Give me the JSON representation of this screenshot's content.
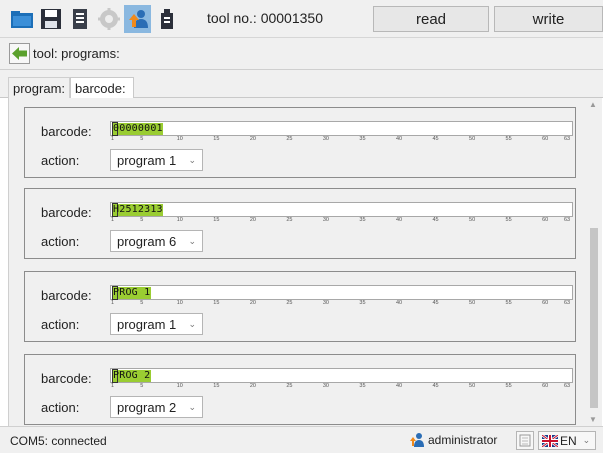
{
  "toolbar": {
    "tool_no": "tool no.: 00001350",
    "read_label": "read",
    "write_label": "write",
    "icons": [
      "open-folder-icon",
      "save-icon",
      "printer-icon",
      "settings-gear-icon",
      "user-upload-icon",
      "usb-device-icon"
    ]
  },
  "breadcrumb": {
    "text": "tool: programs:"
  },
  "tabs": [
    {
      "label": "program:"
    },
    {
      "label": "barcode:"
    }
  ],
  "form_labels": {
    "barcode": "barcode:",
    "action": "action:"
  },
  "ruler_ticks": [
    "1",
    "5",
    "10",
    "15",
    "20",
    "25",
    "30",
    "35",
    "40",
    "45",
    "50",
    "55",
    "60",
    "63"
  ],
  "entries": [
    {
      "barcode": "00000001",
      "action": "program 1"
    },
    {
      "barcode": "H2512313",
      "action": "program 6"
    },
    {
      "barcode": "PROG 1",
      "action": "program 1"
    },
    {
      "barcode": "PROG 2",
      "action": "program 2"
    }
  ],
  "statusbar": {
    "connection": "COM5: connected",
    "user": "administrator",
    "language": "EN"
  },
  "colors": {
    "barcode_highlight": "#9acd32",
    "back_arrow": "#5aa02c"
  }
}
